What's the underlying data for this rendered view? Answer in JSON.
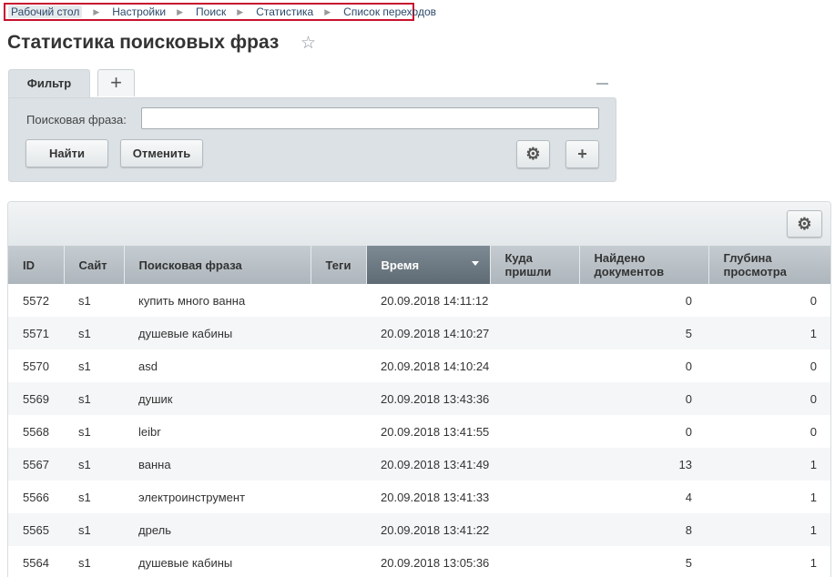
{
  "breadcrumb": [
    "Рабочий стол",
    "Настройки",
    "Поиск",
    "Статистика",
    "Список переходов"
  ],
  "page_title": "Статистика поисковых фраз",
  "filter": {
    "tab_label": "Фильтр",
    "add_tab_label": "+",
    "field_label": "Поисковая фраза:",
    "field_value": "",
    "find_label": "Найти",
    "cancel_label": "Отменить",
    "gear_icon": "⚙",
    "plus_icon": "+"
  },
  "grid": {
    "gear_icon": "⚙",
    "columns": [
      "ID",
      "Сайт",
      "Поисковая фраза",
      "Теги",
      "Время",
      "Куда пришли",
      "Найдено документов",
      "Глубина просмотра"
    ],
    "sorted_column": "Время",
    "rows": [
      {
        "id": "5572",
        "site": "s1",
        "phrase": "купить много ванна",
        "tags": "",
        "time": "20.09.2018 14:11:12",
        "dest": "",
        "found": "0",
        "depth": "0"
      },
      {
        "id": "5571",
        "site": "s1",
        "phrase": "душевые кабины",
        "tags": "",
        "time": "20.09.2018 14:10:27",
        "dest": "",
        "found": "5",
        "depth": "1"
      },
      {
        "id": "5570",
        "site": "s1",
        "phrase": "asd",
        "tags": "",
        "time": "20.09.2018 14:10:24",
        "dest": "",
        "found": "0",
        "depth": "0"
      },
      {
        "id": "5569",
        "site": "s1",
        "phrase": "душик",
        "tags": "",
        "time": "20.09.2018 13:43:36",
        "dest": "",
        "found": "0",
        "depth": "0"
      },
      {
        "id": "5568",
        "site": "s1",
        "phrase": "leibr",
        "tags": "",
        "time": "20.09.2018 13:41:55",
        "dest": "",
        "found": "0",
        "depth": "0"
      },
      {
        "id": "5567",
        "site": "s1",
        "phrase": "ванна",
        "tags": "",
        "time": "20.09.2018 13:41:49",
        "dest": "",
        "found": "13",
        "depth": "1"
      },
      {
        "id": "5566",
        "site": "s1",
        "phrase": "электроинструмент",
        "tags": "",
        "time": "20.09.2018 13:41:33",
        "dest": "",
        "found": "4",
        "depth": "1"
      },
      {
        "id": "5565",
        "site": "s1",
        "phrase": "дрель",
        "tags": "",
        "time": "20.09.2018 13:41:22",
        "dest": "",
        "found": "8",
        "depth": "1"
      },
      {
        "id": "5564",
        "site": "s1",
        "phrase": "душевые кабины",
        "tags": "",
        "time": "20.09.2018 13:05:36",
        "dest": "",
        "found": "5",
        "depth": "1"
      }
    ]
  },
  "colors": {
    "breadcrumb_highlight": "#c8102e",
    "filter_bg": "#dbe1e4",
    "header_bg": "#b7bfc5",
    "sorted_header_bg": "#6b7780"
  }
}
